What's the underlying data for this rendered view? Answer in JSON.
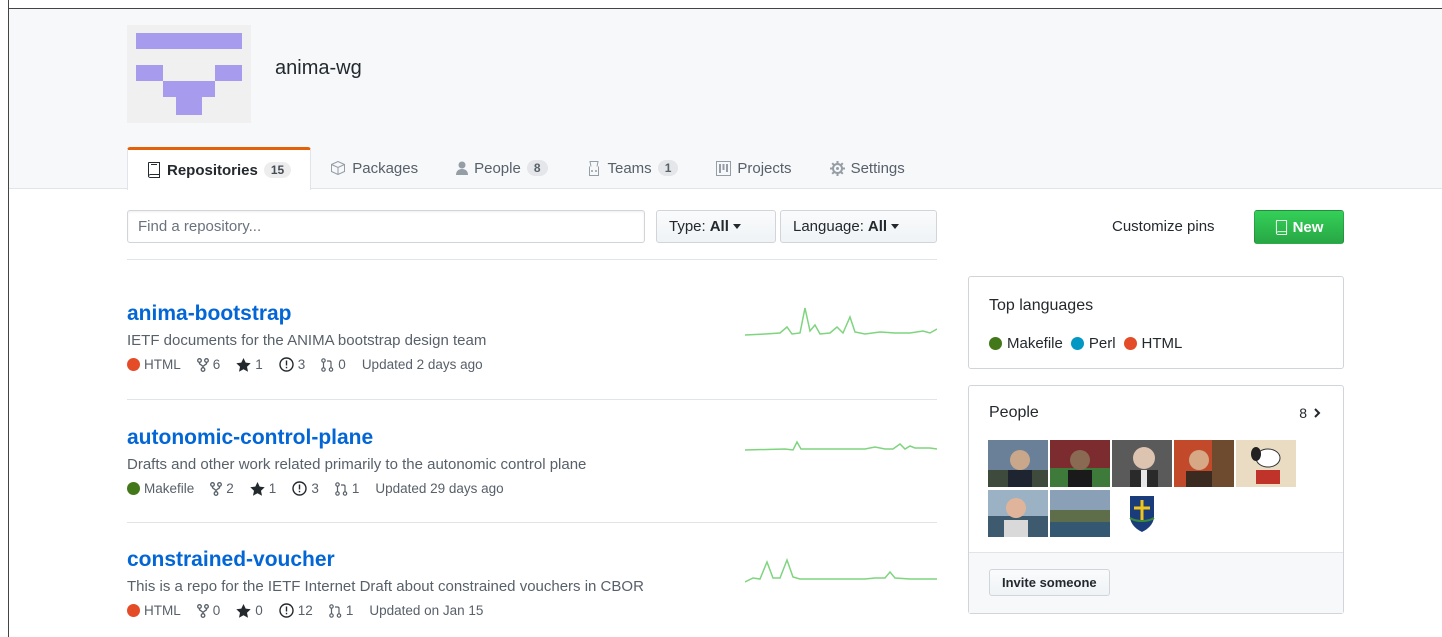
{
  "org": {
    "name": "anima-wg"
  },
  "tabs": [
    {
      "label": "Repositories",
      "count": "15"
    },
    {
      "label": "Packages"
    },
    {
      "label": "People",
      "count": "8"
    },
    {
      "label": "Teams",
      "count": "1"
    },
    {
      "label": "Projects"
    },
    {
      "label": "Settings"
    }
  ],
  "filters": {
    "search_placeholder": "Find a repository...",
    "type_label": "Type:",
    "type_value": "All",
    "language_label": "Language:",
    "language_value": "All"
  },
  "actions": {
    "customize_pins": "Customize pins",
    "new_label": "New"
  },
  "repos": [
    {
      "name": "anima-bootstrap",
      "description": "IETF documents for the ANIMA bootstrap design team",
      "language": "HTML",
      "language_color": "#e34c26",
      "forks": "6",
      "stars": "1",
      "issues": "3",
      "pulls": "0",
      "updated": "Updated 2 days ago"
    },
    {
      "name": "autonomic-control-plane",
      "description": "Drafts and other work related primarily to the autonomic control plane",
      "language": "Makefile",
      "language_color": "#427819",
      "forks": "2",
      "stars": "1",
      "issues": "3",
      "pulls": "1",
      "updated": "Updated 29 days ago"
    },
    {
      "name": "constrained-voucher",
      "description": "This is a repo for the IETF Internet Draft about constrained vouchers in CBOR",
      "language": "HTML",
      "language_color": "#e34c26",
      "forks": "0",
      "stars": "0",
      "issues": "12",
      "pulls": "1",
      "updated": "Updated on Jan 15"
    }
  ],
  "top_languages": {
    "title": "Top languages",
    "items": [
      {
        "name": "Makefile",
        "color": "#427819"
      },
      {
        "name": "Perl",
        "color": "#0298c3"
      },
      {
        "name": "HTML",
        "color": "#e34c26"
      }
    ]
  },
  "people": {
    "title": "People",
    "count": "8",
    "invite_label": "Invite someone"
  }
}
